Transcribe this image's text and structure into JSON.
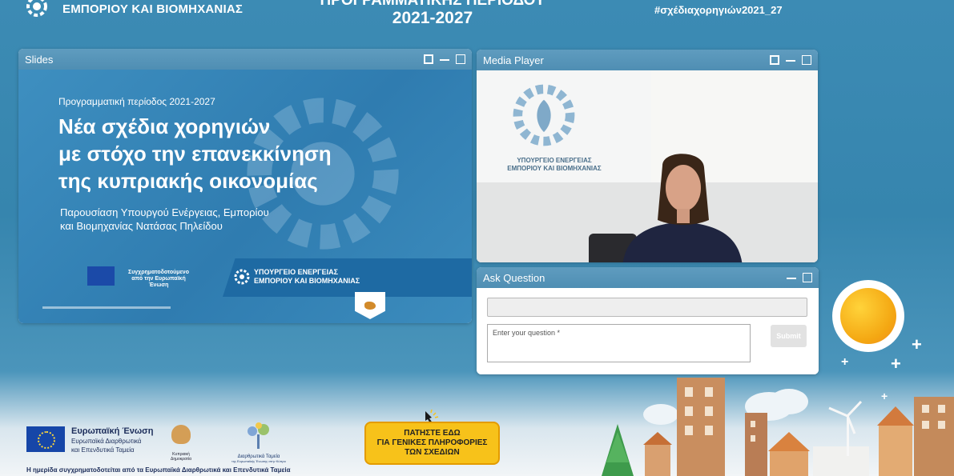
{
  "header": {
    "ministry_name": "ΕΜΠΟΡΙΟΥ ΚΑΙ ΒΙΟΜΗΧΑΝΙΑΣ",
    "title_line1": "ΠΡΟΓΡΑΜΜΑΤΙΚΗΣ ΠΕΡΙΟΔΟΥ",
    "title_line2": "2021-2027",
    "hashtag": "#σχέδιαχορηγιών2021_27"
  },
  "slides_window": {
    "title": "Slides",
    "slide": {
      "period": "Προγραμματική περίοδος 2021-2027",
      "headline_1": "Νέα σχέδια χορηγιών",
      "headline_2": "με στόχο την επανεκκίνηση",
      "headline_3": "της κυπριακής οικονομίας",
      "subtitle_1": "Παρουσίαση Υπουργού Ενέργειας, Εμπορίου",
      "subtitle_2": "και Βιομηχανίας Νατάσας Πηλείδου",
      "eu_caption_1": "Συγχρηματοδοτούμενο",
      "eu_caption_2": "από την Ευρωπαϊκή",
      "eu_caption_3": "Ένωση",
      "ministry_1": "ΥΠΟΥΡΓΕΙΟ ΕΝΕΡΓΕΙΑΣ",
      "ministry_2": "ΕΜΠΟΡΙΟΥ ΚΑΙ ΒΙΟΜΗΧΑΝΙΑΣ"
    }
  },
  "media_window": {
    "title": "Media Player",
    "wall_logo_1": "ΥΠΟΥΡΓΕΙΟ ΕΝΕΡΓΕΙΑΣ",
    "wall_logo_2": "ΕΜΠΟΡΙΟΥ ΚΑΙ ΒΙΟΜΗΧΑΝΙΑΣ"
  },
  "ask_window": {
    "title": "Ask Question",
    "name_value": "",
    "question_placeholder": "Enter your question *",
    "submit_label": "Submit"
  },
  "footer": {
    "eu_title": "Ευρωπαϊκή Ένωση",
    "eu_sub_1": "Ευρωπαϊκά Διαρθρωτικά",
    "eu_sub_2": "και Επενδυτικά Ταμεία",
    "cyprus_label": "Κυπριακή Δημοκρατία",
    "funds_label_1": "Διαρθρωτικά Ταμεία",
    "funds_label_2": "της Ευρωπαϊκής Ένωσης στην Κύπρο",
    "cofinance_note": "Η ημερίδα συγχρηματοδοτείται από τα Ευρωπαϊκά Διαρθρωτικά και Επενδυτικά Ταμεία",
    "info_button_1": "ΠΑΤΗΣΤΕ ΕΔΩ",
    "info_button_2": "ΓΙΑ ΓΕΝΙΚΕΣ ΠΛΗΡΟΦΟΡΙΕΣ",
    "info_button_3": "ΤΩΝ ΣΧΕΔΙΩΝ"
  },
  "colors": {
    "background": "#3c8bb4",
    "window_bar": "#5f9cbf",
    "slide_blue": "#2f7cb0",
    "info_button": "#f7c21a",
    "sun": "#f4a712"
  },
  "icons": {
    "window_controls": [
      "expand-icon",
      "minimize-icon",
      "maximize-icon"
    ],
    "logo": "ministry-gear-icon",
    "pointer": "pointing-hand-icon"
  }
}
